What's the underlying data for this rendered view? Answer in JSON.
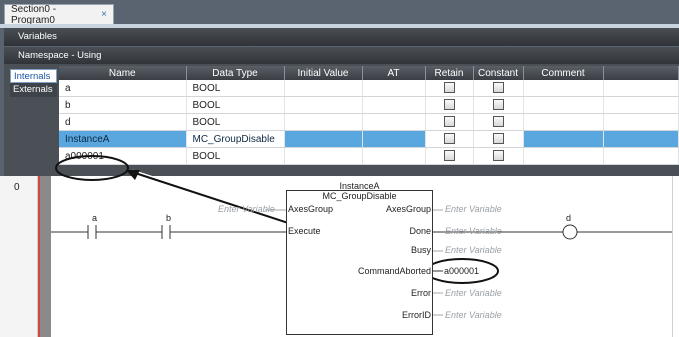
{
  "tab": {
    "title": "Section0 - Program0",
    "close_glyph": "×"
  },
  "sections": {
    "variables": "Variables",
    "namespace": "Namespace - Using"
  },
  "side_tabs": {
    "internals": "Internals",
    "externals": "Externals"
  },
  "table": {
    "headers": [
      "Name",
      "Data Type",
      "Initial Value",
      "AT",
      "Retain",
      "Constant",
      "Comment"
    ],
    "rows": [
      {
        "name": "a",
        "type": "BOOL"
      },
      {
        "name": "b",
        "type": "BOOL"
      },
      {
        "name": "d",
        "type": "BOOL"
      },
      {
        "name": "InstanceA",
        "type": "MC_GroupDisable",
        "selected": true
      },
      {
        "name": "a000001",
        "type": "BOOL"
      }
    ]
  },
  "ladder": {
    "rung_number": "0",
    "contact_a": "a",
    "contact_b": "b",
    "coil_d": "d",
    "instance_name": "InstanceA",
    "fb_type": "MC_GroupDisable",
    "input_axes": "AxesGroup",
    "input_execute": "Execute",
    "output_axes": "AxesGroup",
    "output_done": "Done",
    "output_busy": "Busy",
    "output_abort": "CommandAborted",
    "output_error": "Error",
    "output_errorid": "ErrorID",
    "enter_variable": "Enter Variable",
    "abort_var": "a000001"
  },
  "colors": {
    "accent": "#1a57a4",
    "selected_row": "#5aa7e0",
    "rail": "#d64545"
  }
}
